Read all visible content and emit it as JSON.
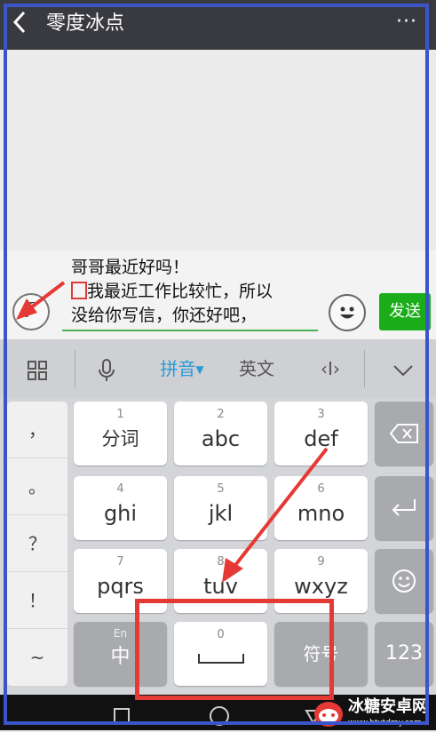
{
  "header": {
    "back_icon": "chevron-left-icon",
    "title": "零度冰点",
    "more_icon": "more-dots-icon",
    "more_glyph": "···"
  },
  "input": {
    "lines": [
      "哥哥最近好吗！",
      "我最近工作比较忙，所以",
      "没给你写信，你还好吧，"
    ],
    "voice_icon": "voice-icon",
    "emoji_icon": "emoji-icon",
    "send_label": "发送"
  },
  "toolbar": {
    "grid_icon": "grid-icon",
    "mic_icon": "mic-icon",
    "pinyin_label": "拼音",
    "english_label": "英文",
    "cursor_glyph": "‹I›",
    "collapse_icon": "chevron-down-icon"
  },
  "keyboard": {
    "punctuation": [
      "，",
      "。",
      "？",
      "！",
      "~"
    ],
    "rows": [
      [
        {
          "num": "1",
          "label": "分词"
        },
        {
          "num": "2",
          "label": "abc"
        },
        {
          "num": "3",
          "label": "def"
        }
      ],
      [
        {
          "num": "4",
          "label": "ghi"
        },
        {
          "num": "5",
          "label": "jkl"
        },
        {
          "num": "6",
          "label": "mno"
        }
      ],
      [
        {
          "num": "7",
          "label": "pqrs"
        },
        {
          "num": "8",
          "label": "tuv"
        },
        {
          "num": "9",
          "label": "wxyz"
        }
      ]
    ],
    "bottom": {
      "lang_hint": "En",
      "lang_label": "中",
      "space_num": "0",
      "symbol_label": "符号",
      "num_label": "123"
    },
    "right_icons": [
      "backspace-icon",
      "enter-icon",
      "emoji-icon"
    ]
  },
  "watermark": {
    "title": "冰糖安卓网",
    "url": "www.btxtdmy.com"
  },
  "colors": {
    "header_bg": "#393a3f",
    "send_bg": "#1aad19",
    "accent_blue": "#2a9bd9",
    "highlight_red": "#e53935",
    "frame_blue": "#3b55c8"
  }
}
